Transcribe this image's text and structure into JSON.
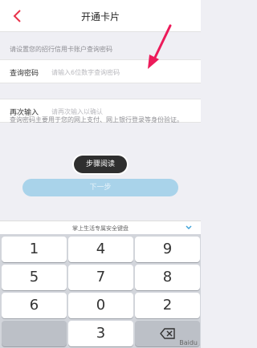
{
  "nav": {
    "title": "开通卡片"
  },
  "hint": "请设置您的招行信用卡账户查询密码",
  "query_password": {
    "label": "查询密码",
    "placeholder": "请输入6位数字查询密码"
  },
  "confirm_password": {
    "label": "再次输入",
    "placeholder": "请再次输入以确认"
  },
  "note": "查询密码主要用于您的网上支付、网上银行登录等身份验证。",
  "overlay_badge": "步骤阅读",
  "next_button": "下一步",
  "keyboard": {
    "title": "掌上生活专属安全键盘",
    "keys": [
      "1",
      "4",
      "9",
      "5",
      "7",
      "8",
      "6",
      "0",
      "2",
      "",
      "3",
      ""
    ]
  },
  "brand": "Baidu"
}
